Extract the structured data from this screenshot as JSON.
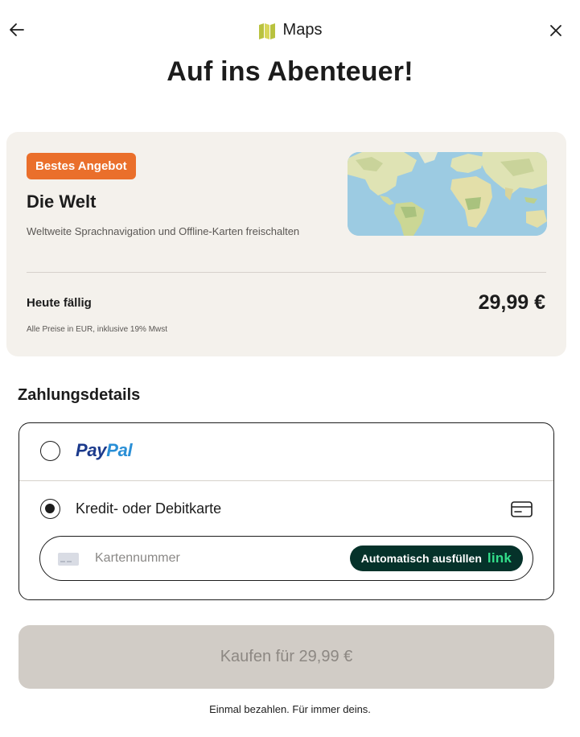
{
  "header": {
    "app_name": "Maps",
    "app_icon": "map-icon",
    "back_icon": "arrow-left-icon",
    "close_icon": "close-icon",
    "title": "Auf ins Abenteuer!"
  },
  "offer": {
    "badge": "Bestes Angebot",
    "title": "Die Welt",
    "description": "Weltweite Sprachnavigation und Offline-Karten freischalten",
    "due_label": "Heute fällig",
    "due_amount": "29,99 €",
    "price_note": "Alle Preise in EUR, inklusive 19% Mwst",
    "colors": {
      "badge": "#ea6f2b",
      "card_bg": "#f4f1ec"
    }
  },
  "payment": {
    "section_title": "Zahlungsdetails",
    "options": [
      {
        "id": "paypal",
        "brand_part1": "Pay",
        "brand_part2": "Pal",
        "selected": false
      },
      {
        "id": "card",
        "label": "Kredit- oder Debitkarte",
        "selected": true,
        "icon": "credit-card-icon"
      }
    ],
    "card_number": {
      "value": "",
      "placeholder": "Kartennummer"
    },
    "autofill": {
      "label": "Automatisch ausfüllen",
      "brand": "link"
    }
  },
  "buy_button": {
    "label": "Kaufen für 29,99 €",
    "enabled": false
  },
  "footnote": "Einmal bezahlen. Für immer deins.",
  "colors": {
    "text": "#1c1c1c",
    "autofill_bg": "#05322a",
    "autofill_accent": "#33de8a",
    "buy_disabled_bg": "#d1ccc6",
    "paypal_dark": "#1b3a8c",
    "paypal_light": "#2a8fd6"
  }
}
